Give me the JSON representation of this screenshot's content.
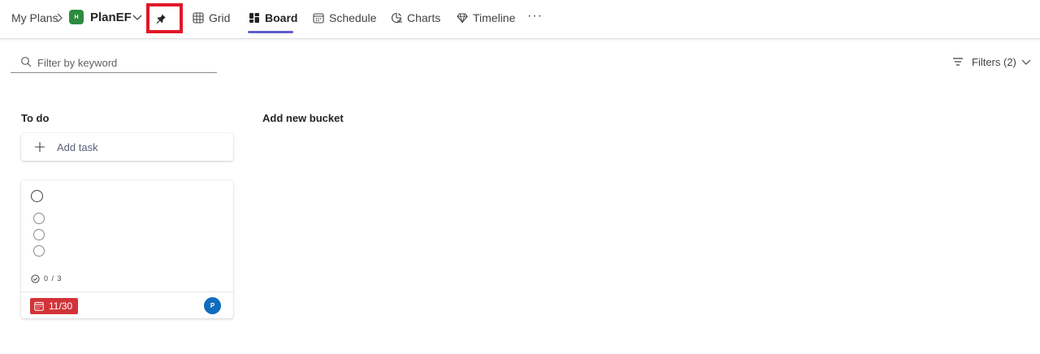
{
  "breadcrumb": {
    "root": "My Plans"
  },
  "plan": {
    "badge": "H",
    "name": "PlanEF",
    "badge_color": "#2e8b3f"
  },
  "nav": {
    "grid": "Grid",
    "board": "Board",
    "schedule": "Schedule",
    "charts": "Charts",
    "timeline": "Timeline",
    "more": "···",
    "active": "board",
    "accent_color": "#5b5fc7"
  },
  "toolbar": {
    "filter_placeholder": "Filter by keyword",
    "filter_value": "",
    "filters_label": "Filters (2)"
  },
  "buckets": [
    {
      "title": "To do",
      "add_task_label": "Add task"
    }
  ],
  "add_bucket_label": "Add new bucket",
  "task_card": {
    "title": "",
    "checklist_count": 3,
    "progress": "0 / 3",
    "due_date": "11/30",
    "due_color": "#d13438",
    "assignee_initial": "P",
    "assignee_color": "#0f6cbd"
  },
  "icons": [
    "chevron-right-icon",
    "chevron-down-icon",
    "pin-icon",
    "grid-icon",
    "board-icon",
    "calendar-icon",
    "chart-icon",
    "diamond-icon",
    "more-icon",
    "search-icon",
    "filter-lines-icon",
    "plus-icon",
    "check-circle-icon"
  ]
}
